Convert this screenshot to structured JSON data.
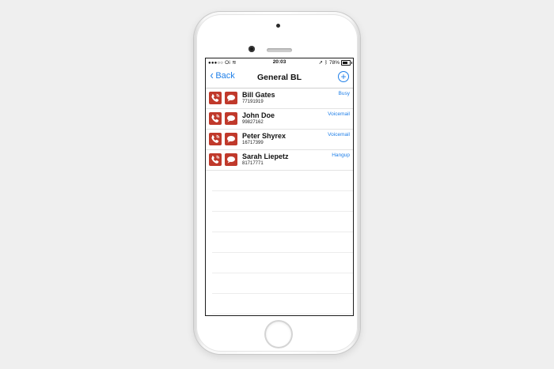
{
  "status_bar": {
    "carrier": "Oi",
    "time": "20:03",
    "battery": "78%",
    "battery_level": 0.78
  },
  "nav": {
    "back_label": "Back",
    "title": "General BL"
  },
  "contacts": [
    {
      "name": "Bill Gates",
      "number": "77191919",
      "action": "Busy"
    },
    {
      "name": "John Doe",
      "number": "99827162",
      "action": "Voicemail"
    },
    {
      "name": "Peter Shyrex",
      "number": "16717399",
      "action": "Voicemail"
    },
    {
      "name": "Sarah Liepetz",
      "number": "81717771",
      "action": "Hangup"
    }
  ],
  "colors": {
    "accent": "#1f7fe8",
    "icon_bg": "#c0392b"
  }
}
